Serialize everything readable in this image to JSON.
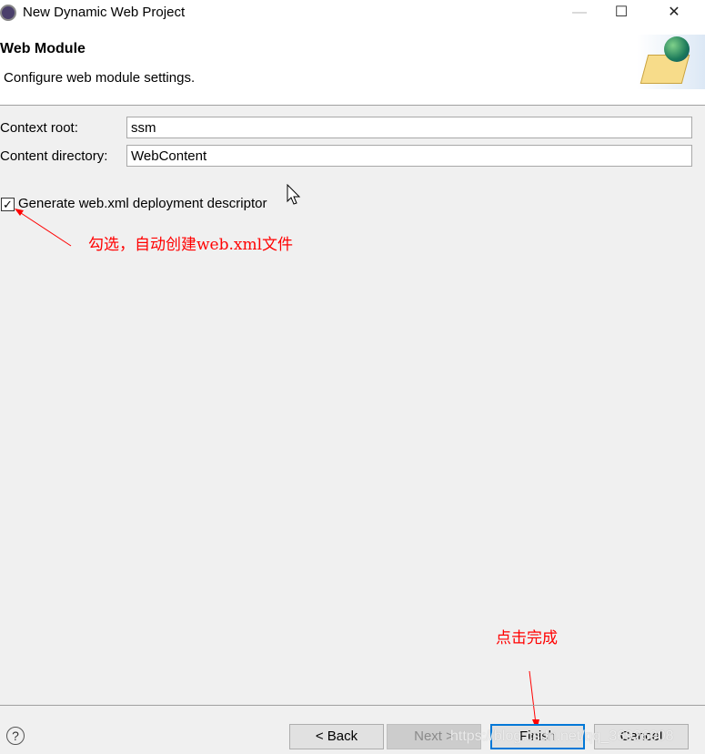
{
  "window": {
    "title": "New Dynamic Web Project",
    "minimize": "—",
    "maximize": "☐",
    "close": "✕"
  },
  "header": {
    "title": "Web Module",
    "description": "Configure web module settings."
  },
  "form": {
    "context_root": {
      "label": "Context root:",
      "value": "ssm"
    },
    "content_directory": {
      "label": "Content directory:",
      "value": "WebContent"
    },
    "generate_descriptor": {
      "label": "Generate web.xml deployment descriptor",
      "checked": true,
      "mark": "✓"
    }
  },
  "annotations": {
    "checkbox_note": "勾选，自动创建web.xml文件",
    "finish_note": "点击完成",
    "color": "#ff0000"
  },
  "footer": {
    "help": "?",
    "back": "< Back",
    "next": "Next >",
    "finish": "Finish",
    "cancel": "Cancel"
  },
  "watermark": "https://blog.csdn.net/qq_36926908"
}
